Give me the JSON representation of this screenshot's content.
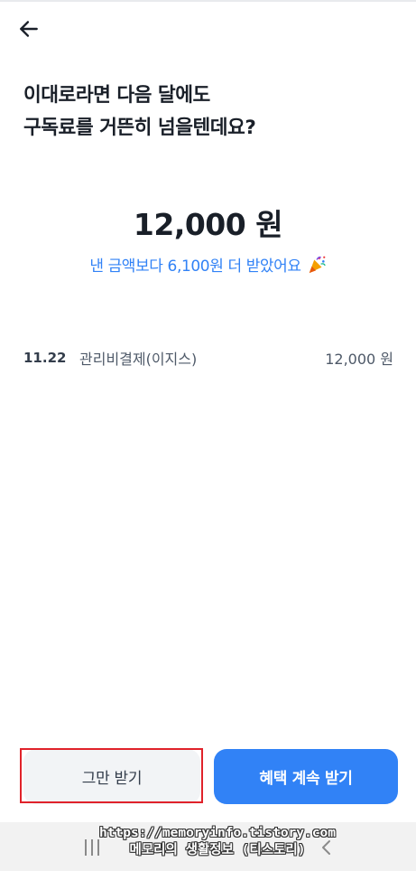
{
  "header": {
    "back_icon": "arrow-left-icon"
  },
  "headline": {
    "line1": "이대로라면 다음 달에도",
    "line2": "구독료를 거뜬히 넘을텐데요?"
  },
  "summary": {
    "amount": "12,000 원",
    "benefit_message": "낸 금액보다 6,100원 더 받았어요",
    "benefit_icon": "party-popper-icon"
  },
  "transactions": [
    {
      "date": "11.22",
      "description": "관리비결제(이지스)",
      "amount": "12,000 원"
    }
  ],
  "actions": {
    "stop_label": "그만 받기",
    "continue_label": "혜택 계속 받기"
  },
  "colors": {
    "accent": "#3182f6",
    "text_primary": "#191f28",
    "text_secondary": "#4e5968",
    "secondary_button_bg": "#f2f4f6",
    "highlight_border": "#e0222a"
  },
  "watermark": {
    "line1": "https://memoryinfo.tistory.com",
    "line2": "메모리의 생활정보 (티스토리)"
  },
  "system_nav": {
    "recent_icon": "recent-apps-icon",
    "back_icon": "chevron-left-icon"
  }
}
